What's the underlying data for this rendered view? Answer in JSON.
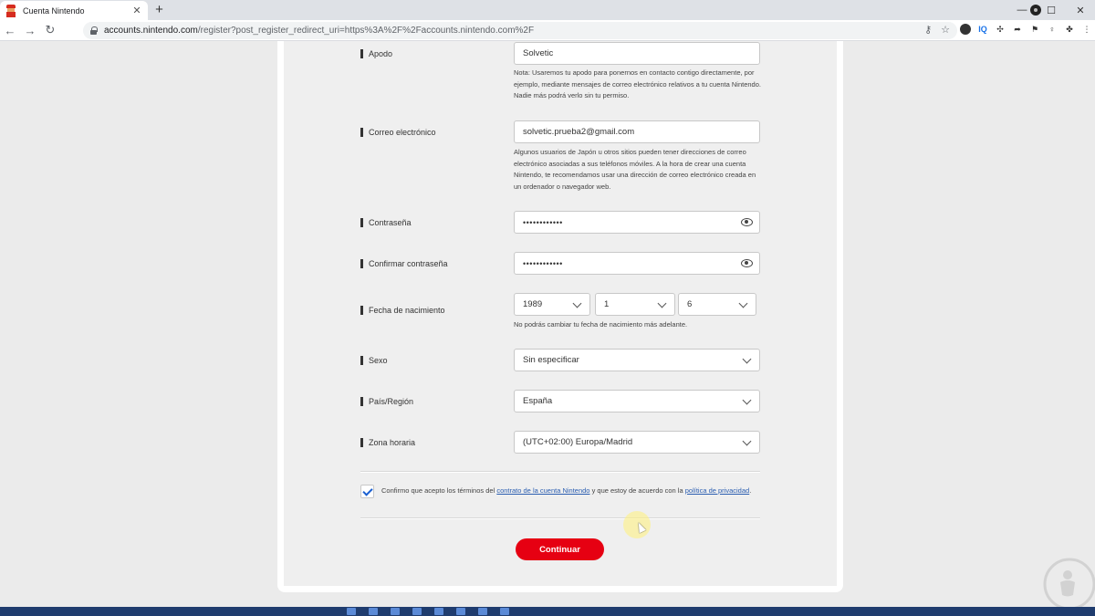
{
  "browser": {
    "tab_title": "Cuenta Nintendo",
    "tab_close": "✕",
    "new_tab": "+",
    "url_host": "accounts.nintendo.com",
    "url_path": "/register?post_register_redirect_uri=https%3A%2F%2Faccounts.nintendo.com%2F",
    "nav_back": "←",
    "nav_forward": "→",
    "nav_reload": "↻",
    "key_icon": "⚷",
    "star_icon": "☆",
    "extensions": [
      "IQ"
    ],
    "window_min": "—",
    "window_max": "☐",
    "window_close": "✕"
  },
  "form": {
    "apodo": {
      "label": "Apodo",
      "value": "Solvetic",
      "note": "Nota: Usaremos tu apodo para ponernos en contacto contigo directamente, por ejemplo, mediante mensajes de correo electrónico relativos a tu cuenta Nintendo. Nadie más podrá verlo sin tu permiso."
    },
    "email": {
      "label": "Correo electrónico",
      "value": "solvetic.prueba2@gmail.com",
      "note": "Algunos usuarios de Japón u otros sitios pueden tener direcciones de correo electrónico asociadas a sus teléfonos móviles. A la hora de crear una cuenta Nintendo, te recomendamos usar una dirección de correo electrónico creada en un ordenador o navegador web."
    },
    "password": {
      "label": "Contraseña",
      "value": "••••••••••••"
    },
    "confirm_password": {
      "label": "Confirmar contraseña",
      "value": "••••••••••••"
    },
    "birthdate": {
      "label": "Fecha de nacimiento",
      "year": "1989",
      "month": "1",
      "day": "6",
      "note": "No podrás cambiar tu fecha de nacimiento más adelante."
    },
    "sexo": {
      "label": "Sexo",
      "value": "Sin especificar"
    },
    "region": {
      "label": "País/Región",
      "value": "España"
    },
    "timezone": {
      "label": "Zona horaria",
      "value": "(UTC+02:00) Europa/Madrid"
    },
    "consent": {
      "checked": true,
      "text_before": "Confirmo que acepto los términos del ",
      "link_contract": "contrato de la cuenta Nintendo",
      "text_middle": " y que estoy de acuerdo con la ",
      "link_privacy": "política de privacidad",
      "text_after": "."
    },
    "submit_label": "Continuar"
  },
  "colors": {
    "accent": "#e60012",
    "link": "#2a5db0",
    "check": "#1a5fd0"
  }
}
